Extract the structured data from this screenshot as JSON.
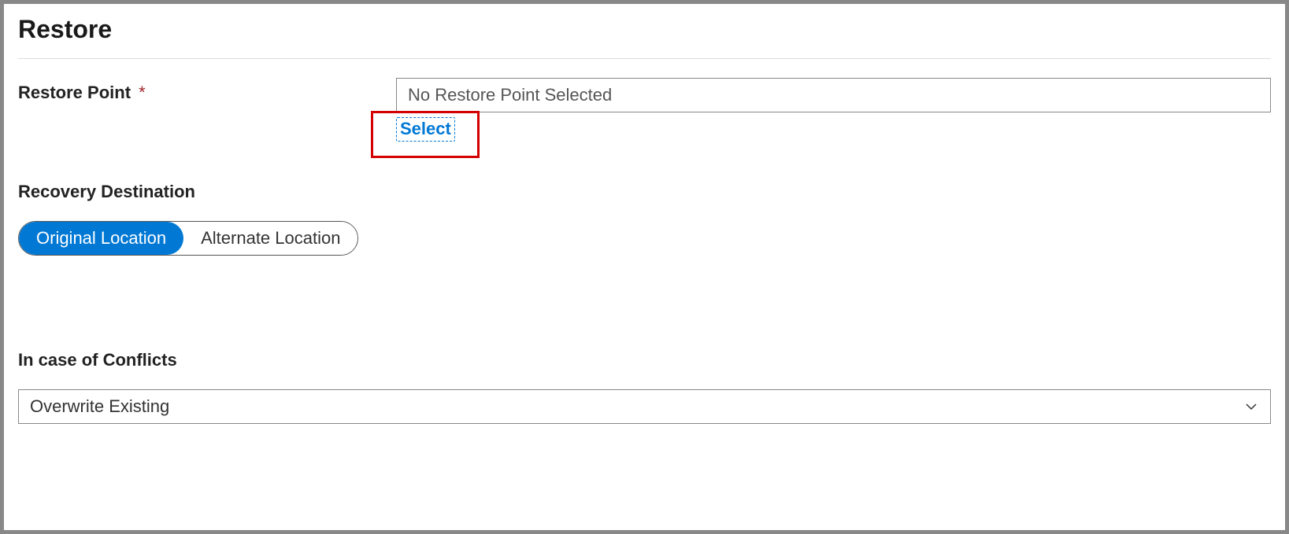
{
  "page_title": "Restore",
  "restore_point": {
    "label": "Restore Point",
    "required_mark": "*",
    "value": "No Restore Point Selected",
    "select_link": "Select"
  },
  "recovery_destination": {
    "label": "Recovery Destination",
    "options": {
      "original": "Original Location",
      "alternate": "Alternate Location"
    }
  },
  "conflicts": {
    "label": "In case of Conflicts",
    "selected": "Overwrite Existing"
  }
}
